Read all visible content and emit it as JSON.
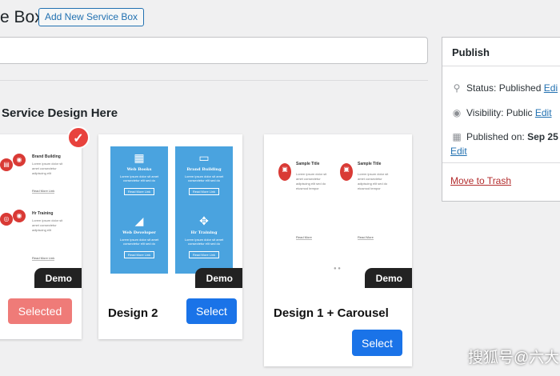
{
  "header": {
    "title": "e Box",
    "add_new_label": "Add New Service Box"
  },
  "section": {
    "title": "Service Design Here"
  },
  "cards": [
    {
      "name": "",
      "demo_label": "Demo",
      "button_label": "Selected",
      "selected": true,
      "check_icon": "check-icon",
      "items": [
        {
          "title": "Brand Building",
          "text": "Lorem ipsum dolor sit amet consectetur adipiscing elit",
          "link": "Read More Link"
        },
        {
          "title": "Hr Training",
          "text": "Lorem ipsum dolor sit amet consectetur adipiscing elit",
          "link": "Read More Link"
        }
      ]
    },
    {
      "name": "Design 2",
      "demo_label": "Demo",
      "button_label": "Select",
      "tiles": [
        {
          "icon": "calendar-icon",
          "title": "Web Books",
          "text": "Lorem ipsum dolor sit amet consectetur elit sed do",
          "button": "Read More Link"
        },
        {
          "icon": "monitor-icon",
          "title": "Brand Building",
          "text": "Lorem ipsum dolor sit amet consectetur elit sed do",
          "button": "Read More Link"
        },
        {
          "icon": "megaphone-icon",
          "title": "Web Developer",
          "text": "Lorem ipsum dolor sit amet consectetur elit sed do",
          "button": "Read More Link"
        },
        {
          "icon": "handshake-icon",
          "title": "Hr Training",
          "text": "Lorem ipsum dolor sit amet consectetur elit sed do",
          "button": "Read More Link"
        }
      ]
    },
    {
      "name": "Design 1 + Carousel",
      "demo_label": "Demo",
      "button_label": "Select",
      "items": [
        {
          "title": "Sample Title",
          "text": "Lorem ipsum dolor sit amet consectetur adipiscing elit sed do eiusmod tempor",
          "link": "Read More"
        },
        {
          "title": "Sample Title",
          "text": "Lorem ipsum dolor sit amet consectetur adipiscing elit sed do eiusmod tempor",
          "link": "Read More"
        }
      ]
    }
  ],
  "publish": {
    "title": "Publish",
    "status_label": "Status:",
    "status_value": "Published",
    "visibility_label": "Visibility:",
    "visibility_value": "Public",
    "published_label": "Published on:",
    "published_value": "Sep 25",
    "edit_label": "Edi",
    "edit_full": "Edit",
    "trash_label": "Move to Trash"
  },
  "watermark": "搜狐号@六大",
  "colors": {
    "accent": "#1a73e8",
    "selected": "#ef7b78",
    "badge": "#e8423d",
    "tile": "#4aa3df",
    "link": "#2271b1"
  }
}
